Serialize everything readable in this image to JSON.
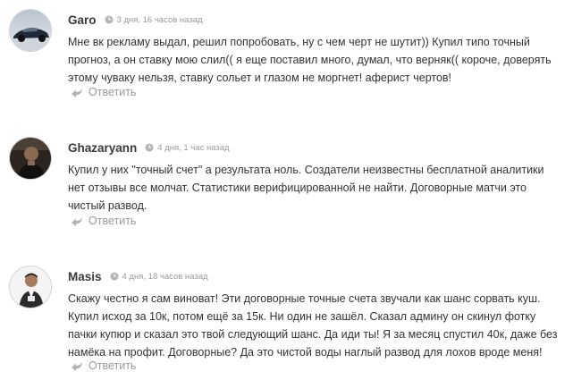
{
  "comments": [
    {
      "author": "Garo",
      "date": "3 дня, 16 часов назад",
      "text": "Мне вк рекламу выдал, решил попробовать, ну с чем черт не шутит)) Купил типо точный прогноз, а он ставку мою слил(( я еще поставил много, думал, что верняк(( короче, доверять этому чуваку нельзя, ставку сольет и глазом не моргнет! аферист чертов!",
      "reply_label": "Ответить",
      "avatar_icon": "avatar-car-icon"
    },
    {
      "author": "Ghazaryann",
      "date": "4 дня, 1 час назад",
      "text": "Купил у них \"точный счет\" а результата ноль. Создатели неизвестны бесплатной аналитики нет отзывы все молчат. Статистики верифицированной не найти. Договорные матчи это чистый развод.",
      "reply_label": "Ответить",
      "avatar_icon": "avatar-person-icon"
    },
    {
      "author": "Masis",
      "date": "4 дня, 18 часов назад",
      "text": "Скажу честно я сам виноват! Эти договорные точные счета звучали как шанс сорвать куш. Купил исход за 10к, потом ещё за 15к. Ни один не зашёл. Сказал админу он скинул фотку пачки купюр и сказал это твой следующий шанс. Да иди ты! Я за месяц спустил 40к, даже без намёка на профит. Договорные? Да это чистой воды наглый развод для лохов вроде меня!",
      "reply_label": "Ответить",
      "avatar_icon": "avatar-person-icon"
    }
  ],
  "colors": {
    "author": "#3a3a3a",
    "date": "#9a9a9a",
    "text": "#333333",
    "reply": "#9a9a9a"
  }
}
